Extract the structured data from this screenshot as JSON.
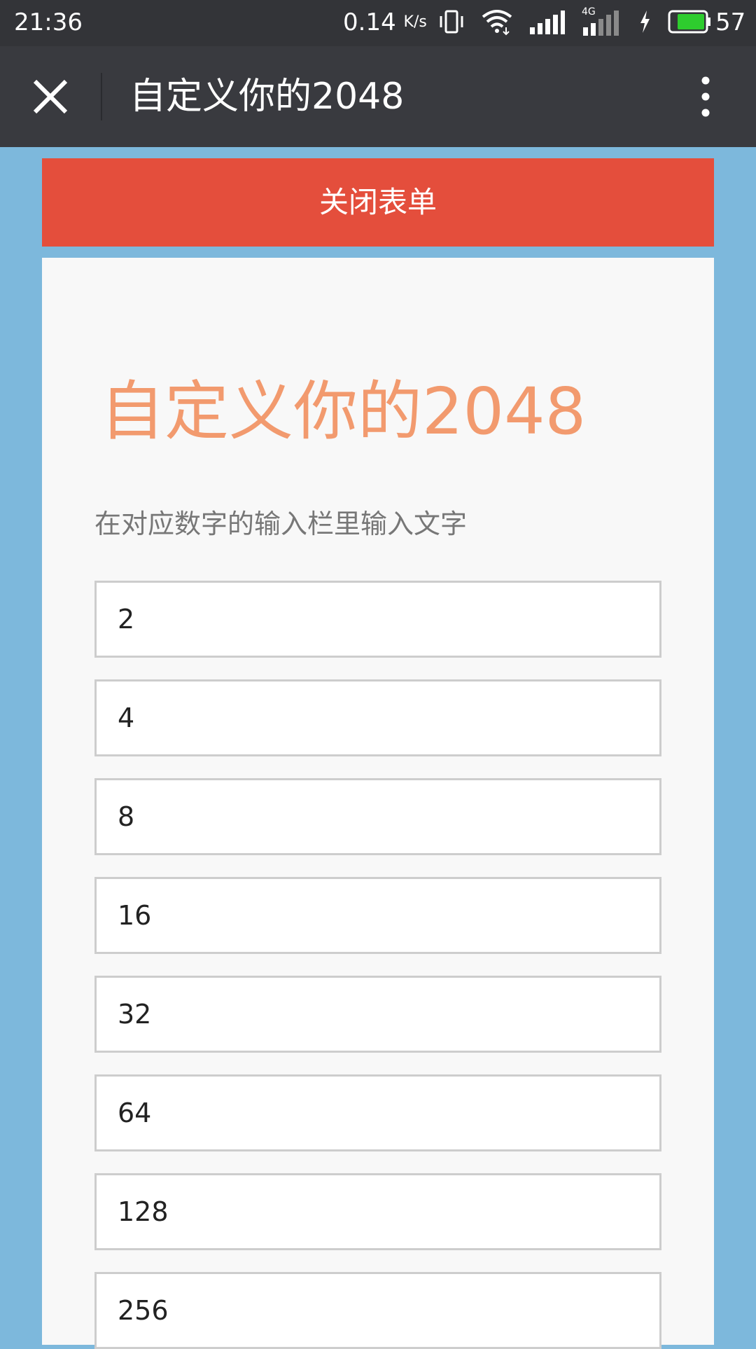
{
  "status_bar": {
    "time": "21:36",
    "net_speed": "0.14",
    "net_unit": "K/s",
    "network": "4G",
    "battery": "57",
    "icons": [
      "vibrate-icon",
      "wifi-icon",
      "signal-icon",
      "signal-4g-icon",
      "charging-icon",
      "battery-icon"
    ]
  },
  "title_bar": {
    "title": "自定义你的2048",
    "close_icon": "close-icon",
    "more_icon": "more-vertical-icon"
  },
  "close_form_label": "关闭表单",
  "form": {
    "title": "自定义你的2048",
    "subtitle": "在对应数字的输入栏里输入文字",
    "fields": [
      {
        "placeholder": "2"
      },
      {
        "placeholder": "4"
      },
      {
        "placeholder": "8"
      },
      {
        "placeholder": "16"
      },
      {
        "placeholder": "32"
      },
      {
        "placeholder": "64"
      },
      {
        "placeholder": "128"
      },
      {
        "placeholder": "256"
      }
    ]
  },
  "colors": {
    "page_background": "#7db8dc",
    "title_bar": "#393a3f",
    "close_form_button": "#e44e3c",
    "form_title": "#f29a6e",
    "battery_fill": "#2ecc2e"
  }
}
